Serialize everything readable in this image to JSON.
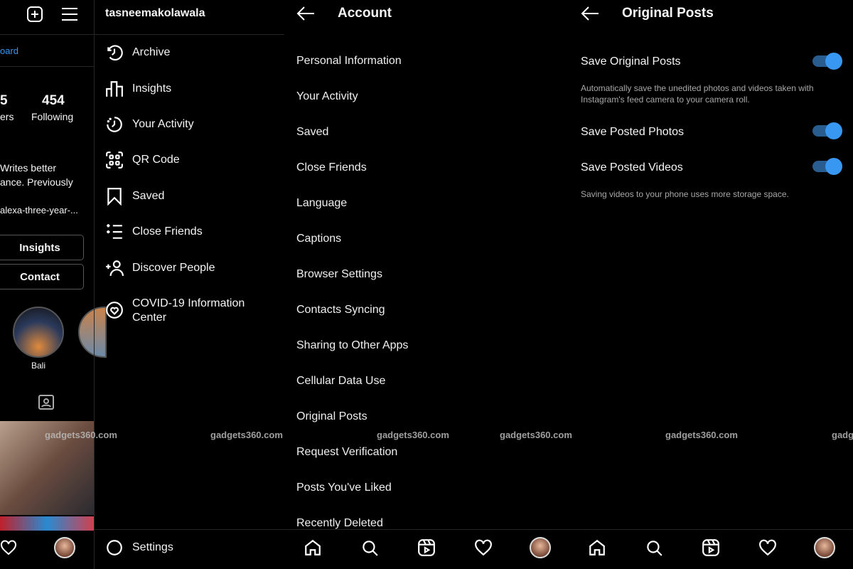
{
  "profile": {
    "link_partial": "oard",
    "followers_count_partial": "5",
    "followers_label_partial": "ers",
    "following_count": "454",
    "following_label": "Following",
    "bio_lines": [
      "Writes better",
      "ance. Previously",
      "alexa-three-year-..."
    ],
    "insights_button": "Insights",
    "contact_button": "Contact",
    "highlight_label": "Bali"
  },
  "menu": {
    "username": "tasneemakolawala",
    "items": [
      {
        "label": "Archive",
        "icon": "archive-icon"
      },
      {
        "label": "Insights",
        "icon": "insights-icon"
      },
      {
        "label": "Your Activity",
        "icon": "activity-icon"
      },
      {
        "label": "QR Code",
        "icon": "qr-code-icon"
      },
      {
        "label": "Saved",
        "icon": "bookmark-icon"
      },
      {
        "label": "Close Friends",
        "icon": "close-friends-icon"
      },
      {
        "label": "Discover People",
        "icon": "add-person-icon"
      },
      {
        "label": "COVID-19 Information Center",
        "icon": "covid-info-icon"
      }
    ],
    "settings": "Settings"
  },
  "account": {
    "title": "Account",
    "items": [
      "Personal Information",
      "Your Activity",
      "Saved",
      "Close Friends",
      "Language",
      "Captions",
      "Browser Settings",
      "Contacts Syncing",
      "Sharing to Other Apps",
      "Cellular Data Use",
      "Original Posts",
      "Request Verification",
      "Posts You've Liked",
      "Recently Deleted"
    ]
  },
  "original_posts": {
    "title": "Original Posts",
    "settings": [
      {
        "label": "Save Original Posts",
        "enabled": true,
        "description": "Automatically save the unedited photos and videos taken with Instagram's feed camera to your camera roll."
      },
      {
        "label": "Save Posted Photos",
        "enabled": true
      },
      {
        "label": "Save Posted Videos",
        "enabled": true,
        "description": "Saving videos to your phone uses more storage space."
      }
    ]
  },
  "watermark": "gadgets360.com",
  "watermark_partial": "gadg",
  "colors": {
    "accent": "#3897f0",
    "toggle_track": "#2a5d8f",
    "background": "#000000"
  }
}
